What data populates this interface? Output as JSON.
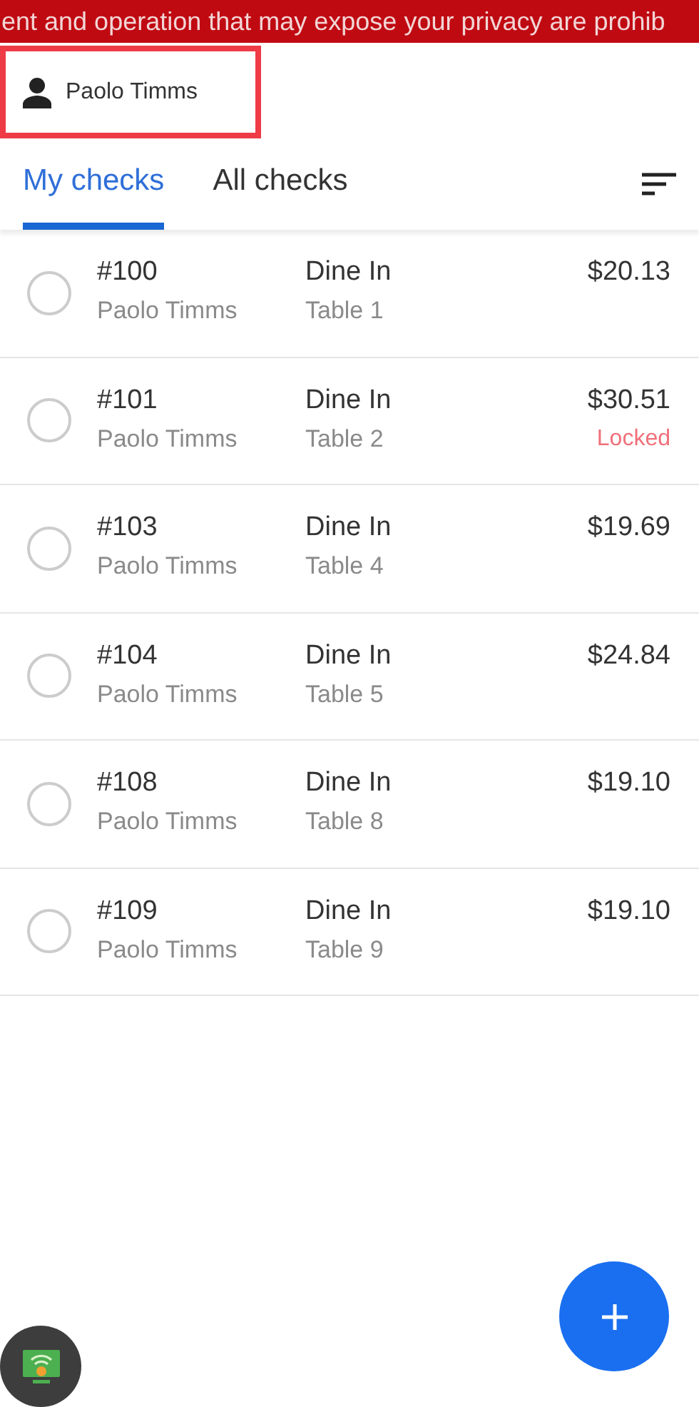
{
  "banner": {
    "text": "ent and operation that may expose your privacy are prohib"
  },
  "user": {
    "name": "Paolo Timms",
    "highlighted": true
  },
  "tabs": [
    {
      "label": "My checks",
      "selected": true
    },
    {
      "label": "All checks",
      "selected": false
    }
  ],
  "checks": [
    {
      "number": "#100",
      "server": "Paolo Timms",
      "type": "Dine In",
      "table": "Table 1",
      "amount": "$20.13",
      "checked": false
    },
    {
      "number": "#101",
      "server": "Paolo Timms",
      "type": "Dine In",
      "table": "Table 2",
      "amount": "$30.51",
      "status": "Locked",
      "checked": false
    },
    {
      "number": "#103",
      "server": "Paolo Timms",
      "type": "Dine In",
      "table": "Table 4",
      "amount": "$19.69",
      "checked": false
    },
    {
      "number": "#104",
      "server": "Paolo Timms",
      "type": "Dine In",
      "table": "Table 5",
      "amount": "$24.84",
      "checked": false
    },
    {
      "number": "#108",
      "server": "Paolo Timms",
      "type": "Dine In",
      "table": "Table 8",
      "amount": "$19.10",
      "checked": false
    },
    {
      "number": "#109",
      "server": "Paolo Timms",
      "type": "Dine In",
      "table": "Table 9",
      "amount": "$19.10",
      "checked": false
    }
  ]
}
